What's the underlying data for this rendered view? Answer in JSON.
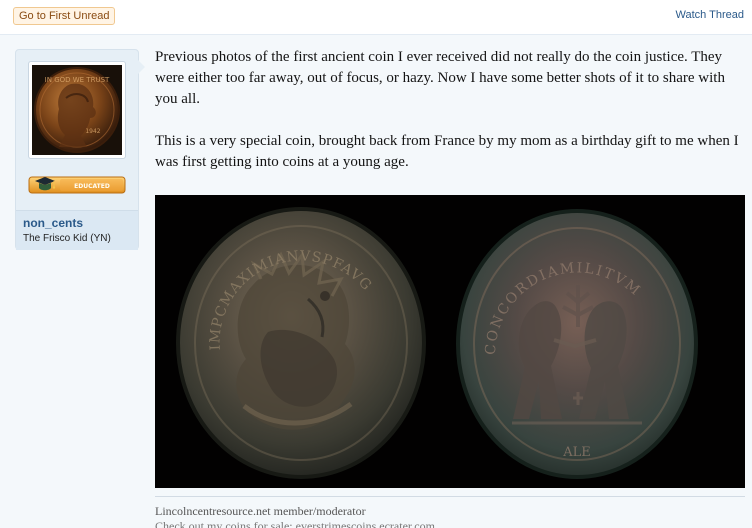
{
  "thread": {
    "first_unread_label": "Go to First Unread",
    "watch_thread_label": "Watch Thread"
  },
  "user": {
    "username": "non_cents",
    "title": "The Frisco Kid (YN)",
    "badge_text": "EDUCATED",
    "avatar_text": "IN GOD WE TRUST"
  },
  "message": {
    "paragraph_1": "Previous photos of the first ancient coin I ever received did not really do the coin justice. They were either too far away, out of focus, or hazy. Now I have some better shots of it to share with you all.",
    "paragraph_2": "This is a very special coin, brought back from France by my mom as a birthday gift to me when I was first getting into coins at a young age.",
    "coin_obverse_legend": "IMPCMAXIMIANVSPFAVG",
    "coin_reverse_legend": "CONCORDIAMILITVM",
    "coin_exergue": "ALE"
  },
  "signature": {
    "line_1": "Lincolncentresource.net member/moderator",
    "line_2": "Check out my coins for sale: everstrimescoins.ecrater.com"
  },
  "colors": {
    "link": "#2b5a8a",
    "card_background": "#e6eff6",
    "button_background": "#fff4e5",
    "badge": "#f0a231"
  }
}
